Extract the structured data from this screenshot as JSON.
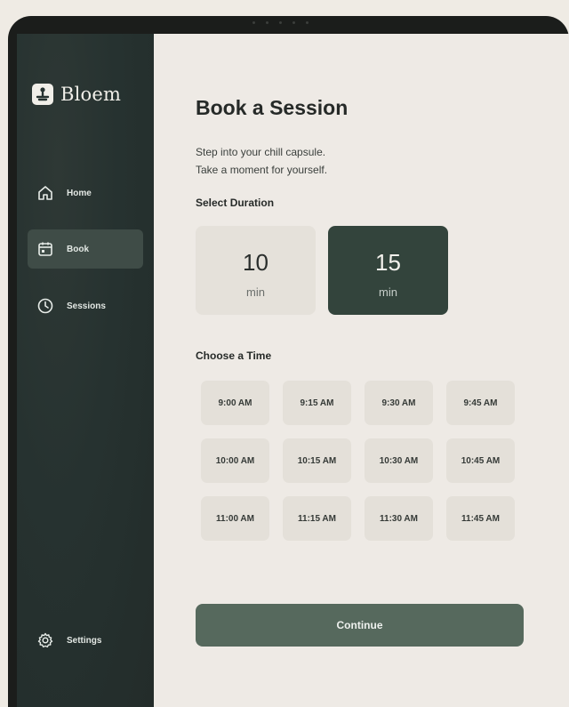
{
  "app": {
    "name": "Bloem",
    "logo_icon": "person-meditating-icon"
  },
  "sidebar": {
    "items": [
      {
        "label": "Home",
        "icon": "home-icon",
        "active": false
      },
      {
        "label": "Book",
        "icon": "calendar-icon",
        "active": true
      },
      {
        "label": "Sessions",
        "icon": "clock-icon",
        "active": false
      }
    ],
    "settings": {
      "label": "Settings",
      "icon": "gear-icon"
    }
  },
  "main": {
    "title": "Book a Session",
    "subtitle_line1": "Step into your chill capsule.",
    "subtitle_line2": "Take a moment for yourself.",
    "duration_label": "Select Duration",
    "durations": [
      {
        "value": "10",
        "unit": "min",
        "selected": false
      },
      {
        "value": "15",
        "unit": "min",
        "selected": true
      }
    ],
    "time_label": "Choose a Time",
    "times": [
      "9:00 AM",
      "9:15 AM",
      "9:30 AM",
      "9:45 AM",
      "10:00 AM",
      "10:15 AM",
      "10:30 AM",
      "10:45 AM",
      "11:00 AM",
      "11:15 AM",
      "11:30 AM",
      "11:45 AM"
    ],
    "continue_label": "Continue"
  },
  "colors": {
    "sidebar_bg": "#263230",
    "content_bg": "#eeeae5",
    "accent_dark": "#33443c",
    "button": "#56695d"
  }
}
